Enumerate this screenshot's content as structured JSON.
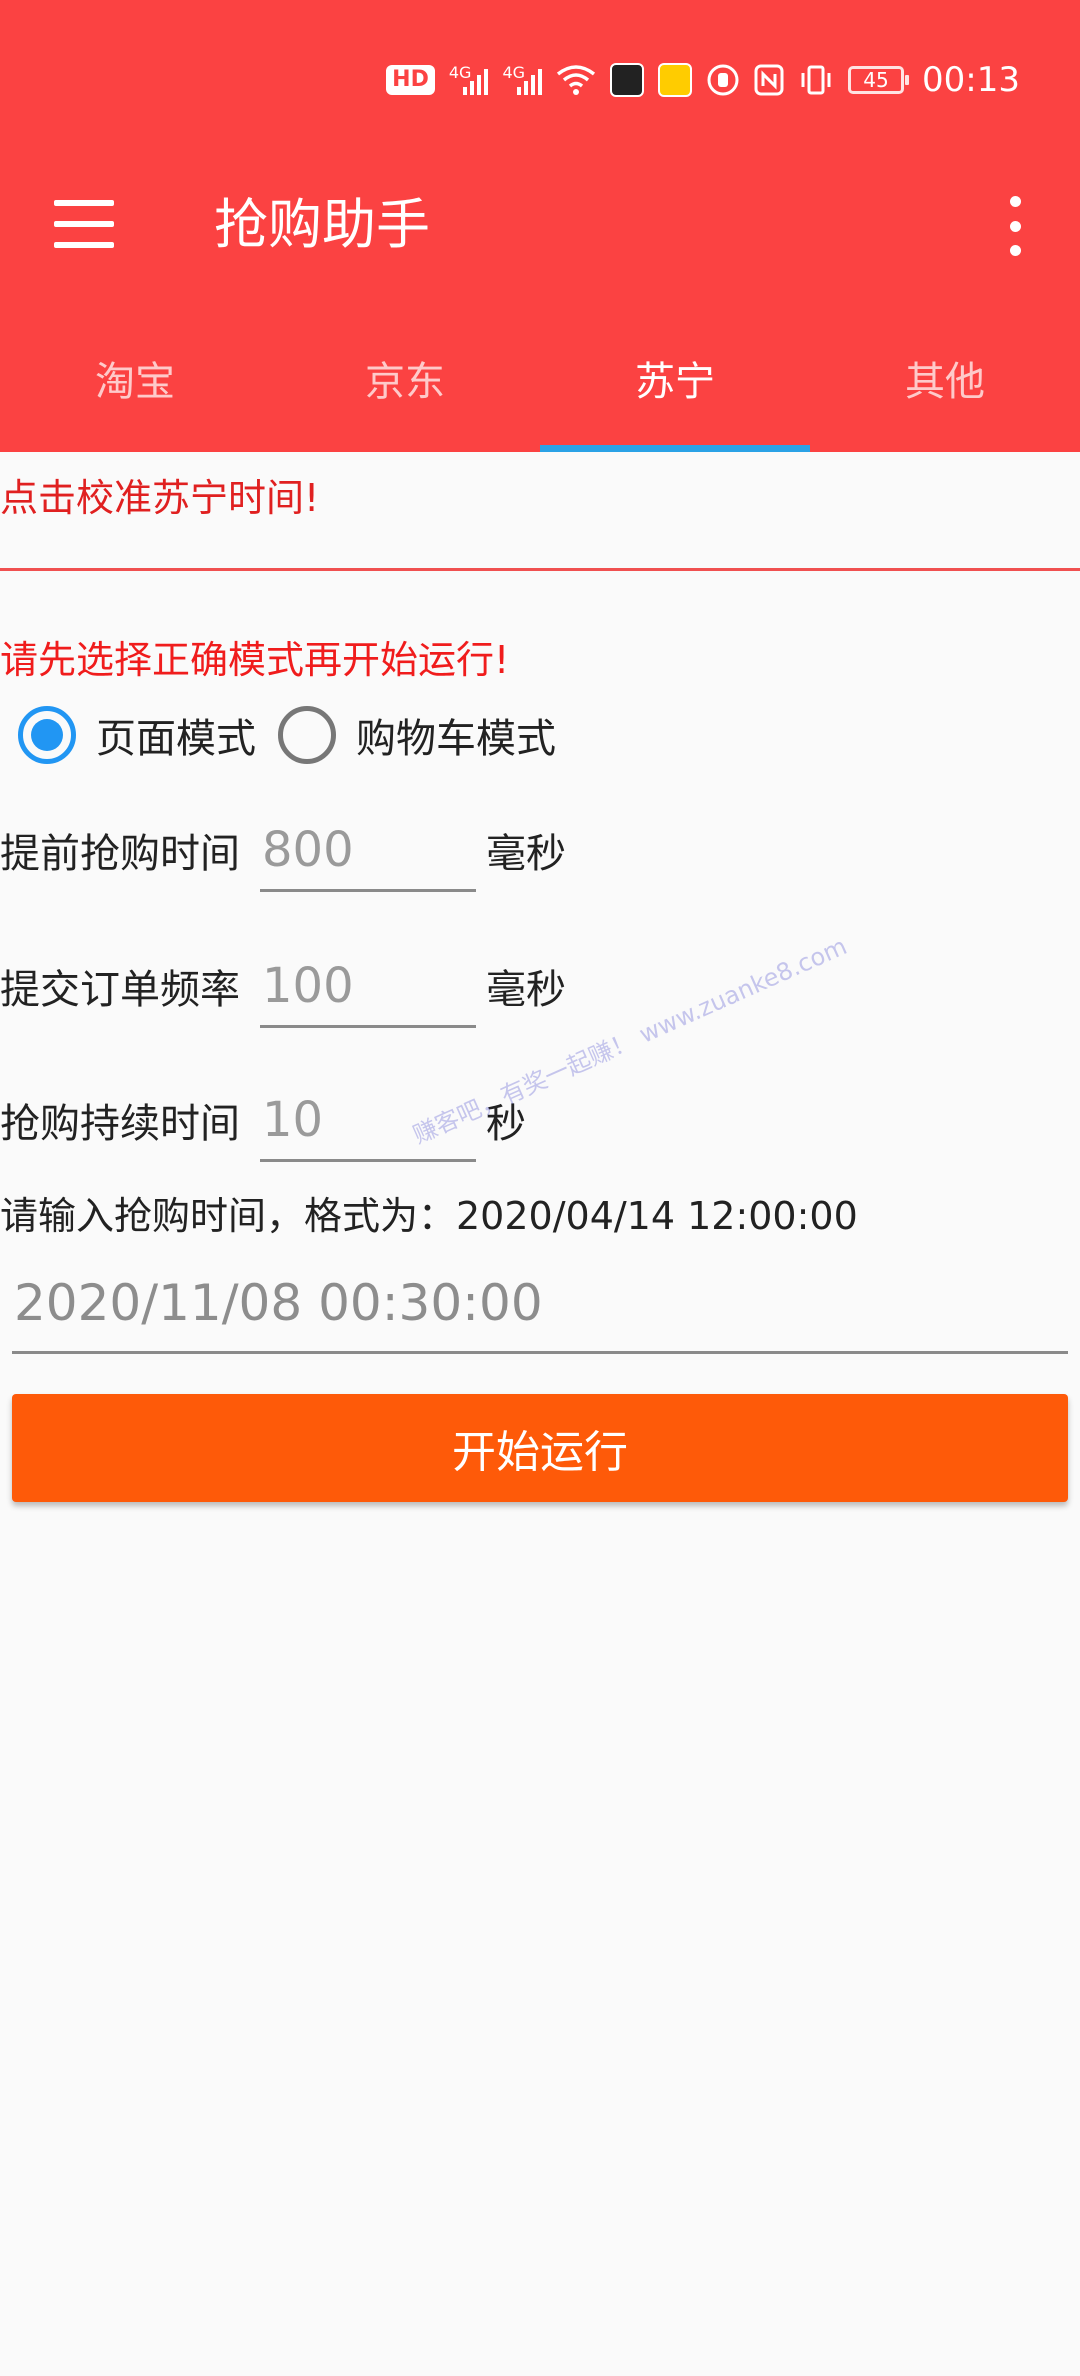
{
  "status_bar": {
    "hd_label": "HD",
    "network1": "4G",
    "network2": "4G",
    "battery": "45",
    "time": "00:13"
  },
  "toolbar": {
    "title": "抢购助手"
  },
  "tabs": [
    {
      "label": "淘宝",
      "active": false
    },
    {
      "label": "京东",
      "active": false
    },
    {
      "label": "苏宁",
      "active": true
    },
    {
      "label": "其他",
      "active": false
    }
  ],
  "calibrate_text": "点击校准苏宁时间!",
  "warning_text": "请先选择正确模式再开始运行!",
  "modes": [
    {
      "label": "页面模式",
      "checked": true
    },
    {
      "label": "购物车模式",
      "checked": false
    }
  ],
  "fields": [
    {
      "label": "提前抢购时间",
      "value": "800",
      "unit": "毫秒"
    },
    {
      "label": "提交订单频率",
      "value": "100",
      "unit": "毫秒"
    },
    {
      "label": "抢购持续时间",
      "value": "10",
      "unit": "秒"
    }
  ],
  "time_hint": "请输入抢购时间，格式为：2020/04/14 12:00:00",
  "time_value": "2020/11/08 00:30:00",
  "watermark": "赚客吧，有奖一起赚！ www.zuanke8.com",
  "start_button": "开始运行",
  "colors": {
    "primary": "#fb4242",
    "tab_indicator": "#2aa2e6",
    "radio_accent": "#2196f3",
    "button": "#fe5a09",
    "warning_text": "#f01c1c"
  }
}
